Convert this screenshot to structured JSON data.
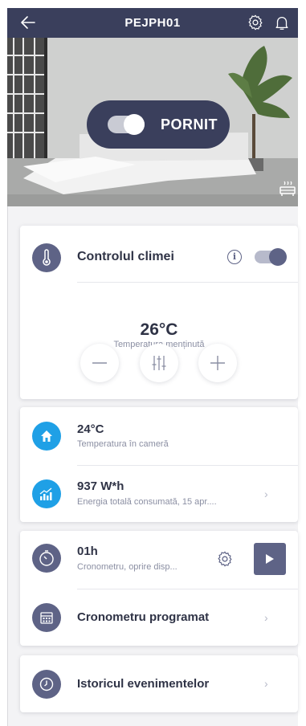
{
  "header": {
    "title": "PEJPH01",
    "icons": {
      "back": "arrow-left-icon",
      "settings": "gear-icon",
      "notifications": "bell-icon"
    }
  },
  "hero": {
    "power_label": "PORNIT",
    "power_on": true,
    "device_icon": "heater-icon"
  },
  "climate": {
    "title": "Controlul climei",
    "enabled": true,
    "target_temp": "26°C",
    "target_label": "Temperatura menținută",
    "controls": [
      "minus-icon",
      "sliders-icon",
      "plus-icon"
    ]
  },
  "room": {
    "value": "24°C",
    "label": "Temperatura în cameră"
  },
  "energy": {
    "value": "937 W*h",
    "label": "Energia totală consumată, 15 apr...."
  },
  "timer": {
    "value": "01h",
    "label": "Cronometru, oprire disp..."
  },
  "scheduled": {
    "title": "Cronometru programat"
  },
  "history": {
    "title": "Istoricul evenimentelor"
  },
  "colors": {
    "header": "#3a3f5c",
    "accent": "#5e6386",
    "blue": "#1fa0e6"
  }
}
